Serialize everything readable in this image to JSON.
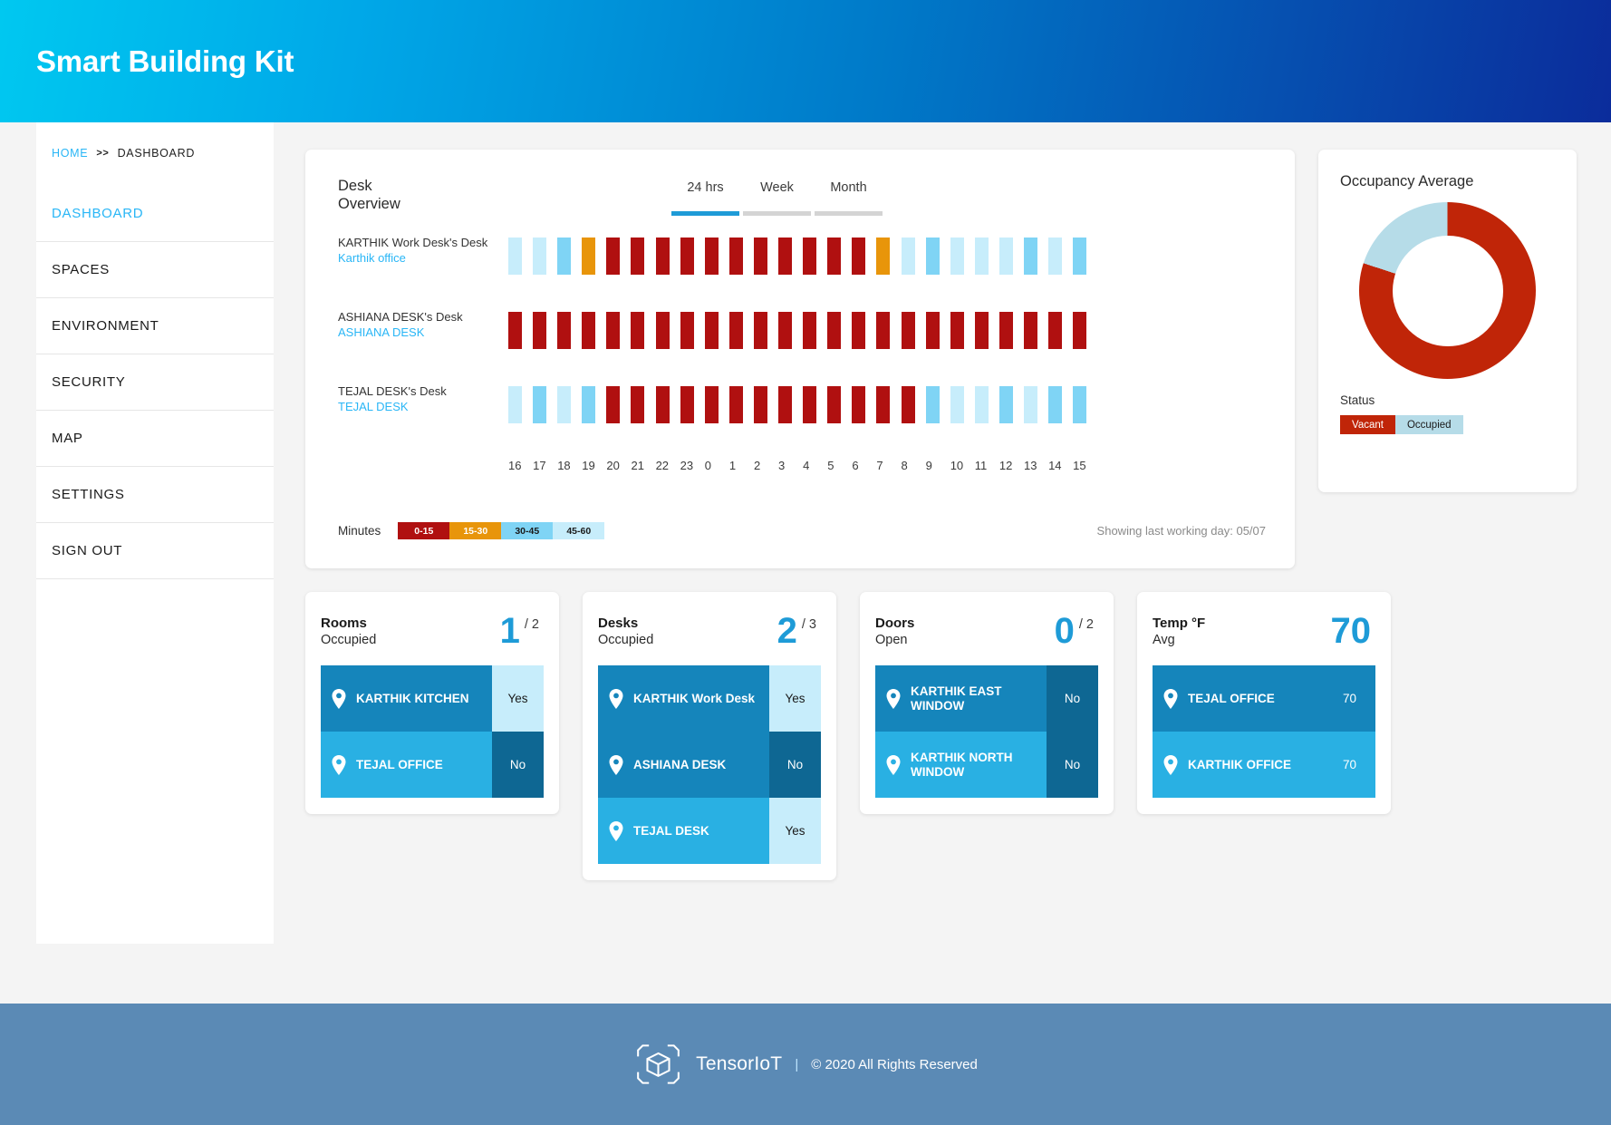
{
  "header": {
    "title": "Smart Building Kit"
  },
  "breadcrumb": {
    "home": "HOME",
    "separator": ">>",
    "current": "DASHBOARD"
  },
  "sidebar": {
    "items": [
      {
        "label": "DASHBOARD",
        "active": true
      },
      {
        "label": "SPACES",
        "active": false
      },
      {
        "label": "ENVIRONMENT",
        "active": false
      },
      {
        "label": "SECURITY",
        "active": false
      },
      {
        "label": "MAP",
        "active": false
      },
      {
        "label": "SETTINGS",
        "active": false
      },
      {
        "label": "SIGN OUT",
        "active": false
      }
    ]
  },
  "desk_overview": {
    "title_line1": "Desk",
    "title_line2": "Overview",
    "tabs": [
      {
        "label": "24 hrs",
        "active": true
      },
      {
        "label": "Week",
        "active": false
      },
      {
        "label": "Month",
        "active": false
      }
    ],
    "legend_label": "Minutes",
    "legend": [
      {
        "label": "0-15",
        "color": "#b01010",
        "text_color": "#ffffff"
      },
      {
        "label": "15-30",
        "color": "#e8950a",
        "text_color": "#ffffff"
      },
      {
        "label": "30-45",
        "color": "#7fd4f5",
        "text_color": "#1a1a1a"
      },
      {
        "label": "45-60",
        "color": "#c7edfb",
        "text_color": "#1a1a1a"
      }
    ],
    "showing_note": "Showing last working day: 05/07"
  },
  "chart_data": {
    "type": "heatmap",
    "title": "Desk Overview",
    "xlabel": "",
    "ylabel": "",
    "grid": false,
    "legend_position": "bottom-left",
    "color_scale": [
      {
        "bucket": "0-15",
        "color": "#b01010"
      },
      {
        "bucket": "15-30",
        "color": "#e8950a"
      },
      {
        "bucket": "30-45",
        "color": "#7fd4f5"
      },
      {
        "bucket": "45-60",
        "color": "#c7edfb"
      }
    ],
    "x": [
      "16",
      "17",
      "18",
      "19",
      "20",
      "21",
      "22",
      "23",
      "0",
      "1",
      "2",
      "3",
      "4",
      "5",
      "6",
      "7",
      "8",
      "9",
      "10",
      "11",
      "12",
      "13",
      "14",
      "15"
    ],
    "series": [
      {
        "name": "KARTHIK Work Desk's Desk",
        "location": "Karthik office",
        "values": [
          "45-60",
          "45-60",
          "30-45",
          "15-30",
          "0-15",
          "0-15",
          "0-15",
          "0-15",
          "0-15",
          "0-15",
          "0-15",
          "0-15",
          "0-15",
          "0-15",
          "0-15",
          "15-30",
          "45-60",
          "30-45",
          "45-60",
          "45-60",
          "45-60",
          "30-45",
          "45-60",
          "30-45"
        ]
      },
      {
        "name": "ASHIANA DESK's Desk",
        "location": "ASHIANA DESK",
        "values": [
          "0-15",
          "0-15",
          "0-15",
          "0-15",
          "0-15",
          "0-15",
          "0-15",
          "0-15",
          "0-15",
          "0-15",
          "0-15",
          "0-15",
          "0-15",
          "0-15",
          "0-15",
          "0-15",
          "0-15",
          "0-15",
          "0-15",
          "0-15",
          "0-15",
          "0-15",
          "0-15",
          "0-15"
        ]
      },
      {
        "name": "TEJAL DESK's Desk",
        "location": "TEJAL DESK",
        "values": [
          "45-60",
          "30-45",
          "45-60",
          "30-45",
          "0-15",
          "0-15",
          "0-15",
          "0-15",
          "0-15",
          "0-15",
          "0-15",
          "0-15",
          "0-15",
          "0-15",
          "0-15",
          "0-15",
          "0-15",
          "30-45",
          "45-60",
          "45-60",
          "30-45",
          "45-60",
          "30-45",
          "30-45"
        ]
      }
    ]
  },
  "occupancy": {
    "title": "Occupancy Average",
    "status_label": "Status",
    "chart": {
      "type": "pie",
      "title": "Occupancy Average",
      "labels": [
        "Vacant",
        "Occupied"
      ],
      "values": [
        80,
        20
      ],
      "colors": [
        "#c02508",
        "#b6dce8"
      ]
    },
    "legend": [
      {
        "label": "Vacant",
        "color": "#c02508",
        "text_color": "#ffffff"
      },
      {
        "label": "Occupied",
        "color": "#b6dce8",
        "text_color": "#1a1a1a"
      }
    ]
  },
  "stat_cards": [
    {
      "name": "Rooms",
      "sub": "Occupied",
      "value": "1",
      "denominator": "/ 2",
      "rows": [
        {
          "label": "KARTHIK KITCHEN",
          "value": "Yes",
          "row_color": "#1585bb",
          "value_bg": "#c7edfb",
          "value_color": "#1a1a1a"
        },
        {
          "label": "TEJAL OFFICE",
          "value": "No",
          "row_color": "#29b0e3",
          "value_bg": "#0e6793",
          "value_color": "#ffffff"
        }
      ]
    },
    {
      "name": "Desks",
      "sub": "Occupied",
      "value": "2",
      "denominator": "/ 3",
      "rows": [
        {
          "label": "KARTHIK Work Desk",
          "value": "Yes",
          "row_color": "#1585bb",
          "value_bg": "#c7edfb",
          "value_color": "#1a1a1a"
        },
        {
          "label": "ASHIANA DESK",
          "value": "No",
          "row_color": "#1585bb",
          "value_bg": "#0e6793",
          "value_color": "#ffffff"
        },
        {
          "label": "TEJAL DESK",
          "value": "Yes",
          "row_color": "#29b0e3",
          "value_bg": "#c7edfb",
          "value_color": "#1a1a1a"
        }
      ]
    },
    {
      "name": "Doors",
      "sub": "Open",
      "value": "0",
      "denominator": "/ 2",
      "rows": [
        {
          "label": "KARTHIK EAST WINDOW",
          "value": "No",
          "row_color": "#1585bb",
          "value_bg": "#0e6793",
          "value_color": "#ffffff"
        },
        {
          "label": "KARTHIK NORTH WINDOW",
          "value": "No",
          "row_color": "#29b0e3",
          "value_bg": "#0e6793",
          "value_color": "#ffffff"
        }
      ]
    },
    {
      "name": "Temp °F",
      "sub": "Avg",
      "value": "70",
      "denominator": "",
      "rows": [
        {
          "label": "TEJAL OFFICE",
          "value": "70",
          "row_color": "#1585bb",
          "value_bg": "#1585bb",
          "value_color": "#ffffff"
        },
        {
          "label": "KARTHIK OFFICE",
          "value": "70",
          "row_color": "#29b0e3",
          "value_bg": "#29b0e3",
          "value_color": "#ffffff"
        }
      ]
    }
  ],
  "footer": {
    "brand": "TensorIoT",
    "separator": "|",
    "copyright": "© 2020 All Rights Reserved"
  }
}
